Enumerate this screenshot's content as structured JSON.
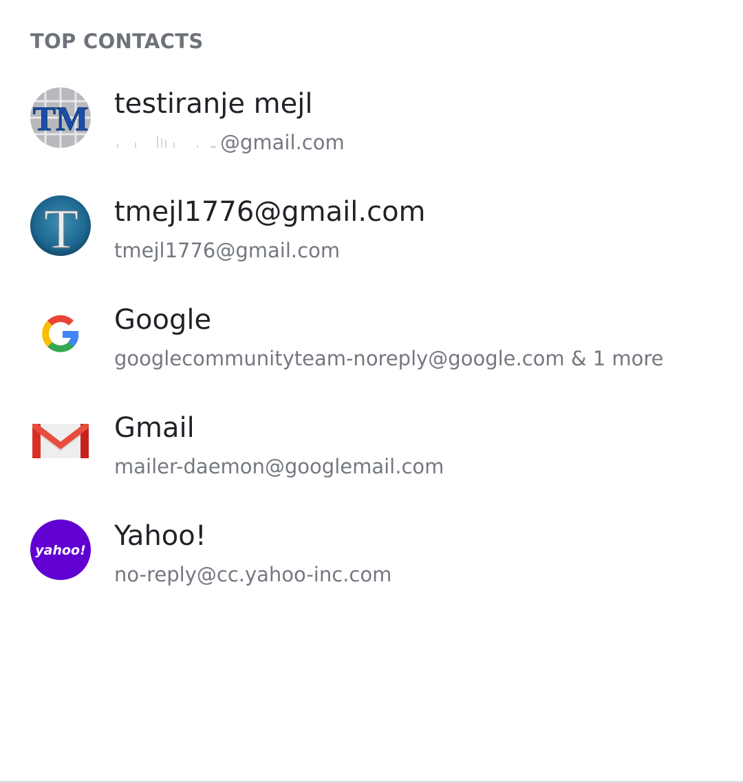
{
  "section": {
    "title": "TOP CONTACTS"
  },
  "contacts": [
    {
      "name": "testiranje mejl",
      "email_visible_suffix": "@gmail.com",
      "avatar_icon": "tm-photo-avatar"
    },
    {
      "name": "tmejl1776@gmail.com",
      "email": "tmejl1776@gmail.com",
      "avatar_icon": "t-letter-photo-avatar"
    },
    {
      "name": "Google",
      "email": "googlecommunityteam-noreply@google.com & 1 more",
      "avatar_icon": "google-g-icon"
    },
    {
      "name": "Gmail",
      "email": "mailer-daemon@googlemail.com",
      "avatar_icon": "gmail-envelope-icon"
    },
    {
      "name": "Yahoo!",
      "email": "no-reply@cc.yahoo-inc.com",
      "avatar_icon": "yahoo-logo-icon",
      "avatar_logo_text": "yahoo!"
    }
  ],
  "colors": {
    "header_text": "#6e7379",
    "name_text": "#1f2227",
    "email_text": "#737880",
    "yahoo_purple": "#6001d2",
    "gmail_red": "#d93025"
  }
}
